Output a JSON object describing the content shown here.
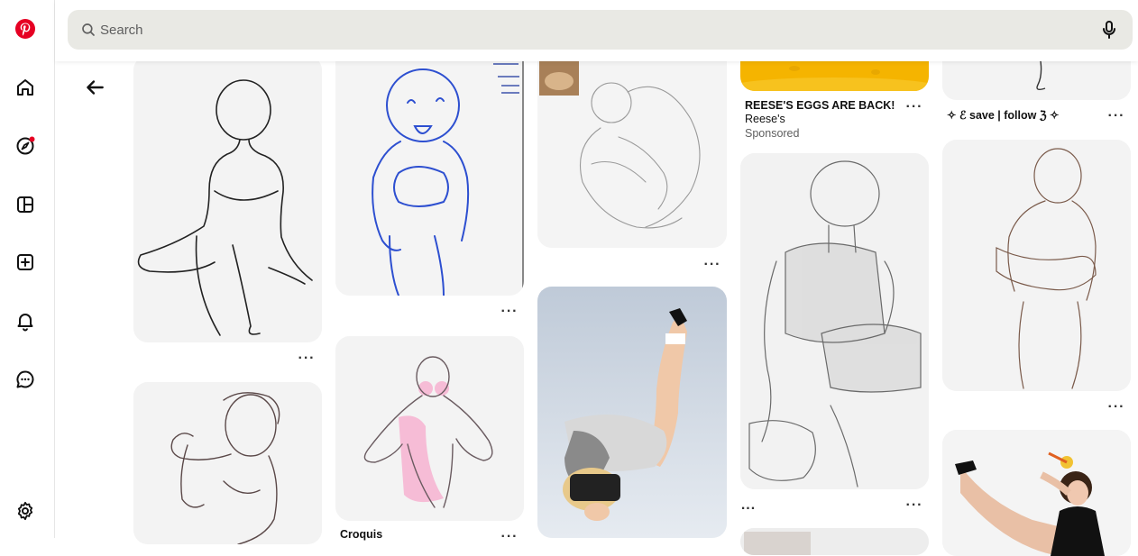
{
  "search": {
    "placeholder": "Search"
  },
  "pins": {
    "ad": {
      "title": "REESE'S EGGS ARE BACK!",
      "advertiser": "Reese's",
      "sponsored": "Sponsored"
    },
    "save_follow": {
      "title": "✧ ℰ save | follow ℨ ✧"
    },
    "croquis": {
      "title": "Croquis"
    },
    "more_label": "···",
    "short_label": "..."
  },
  "colors": {
    "brand": "#e60023",
    "search_bg": "#e9e9e4"
  }
}
